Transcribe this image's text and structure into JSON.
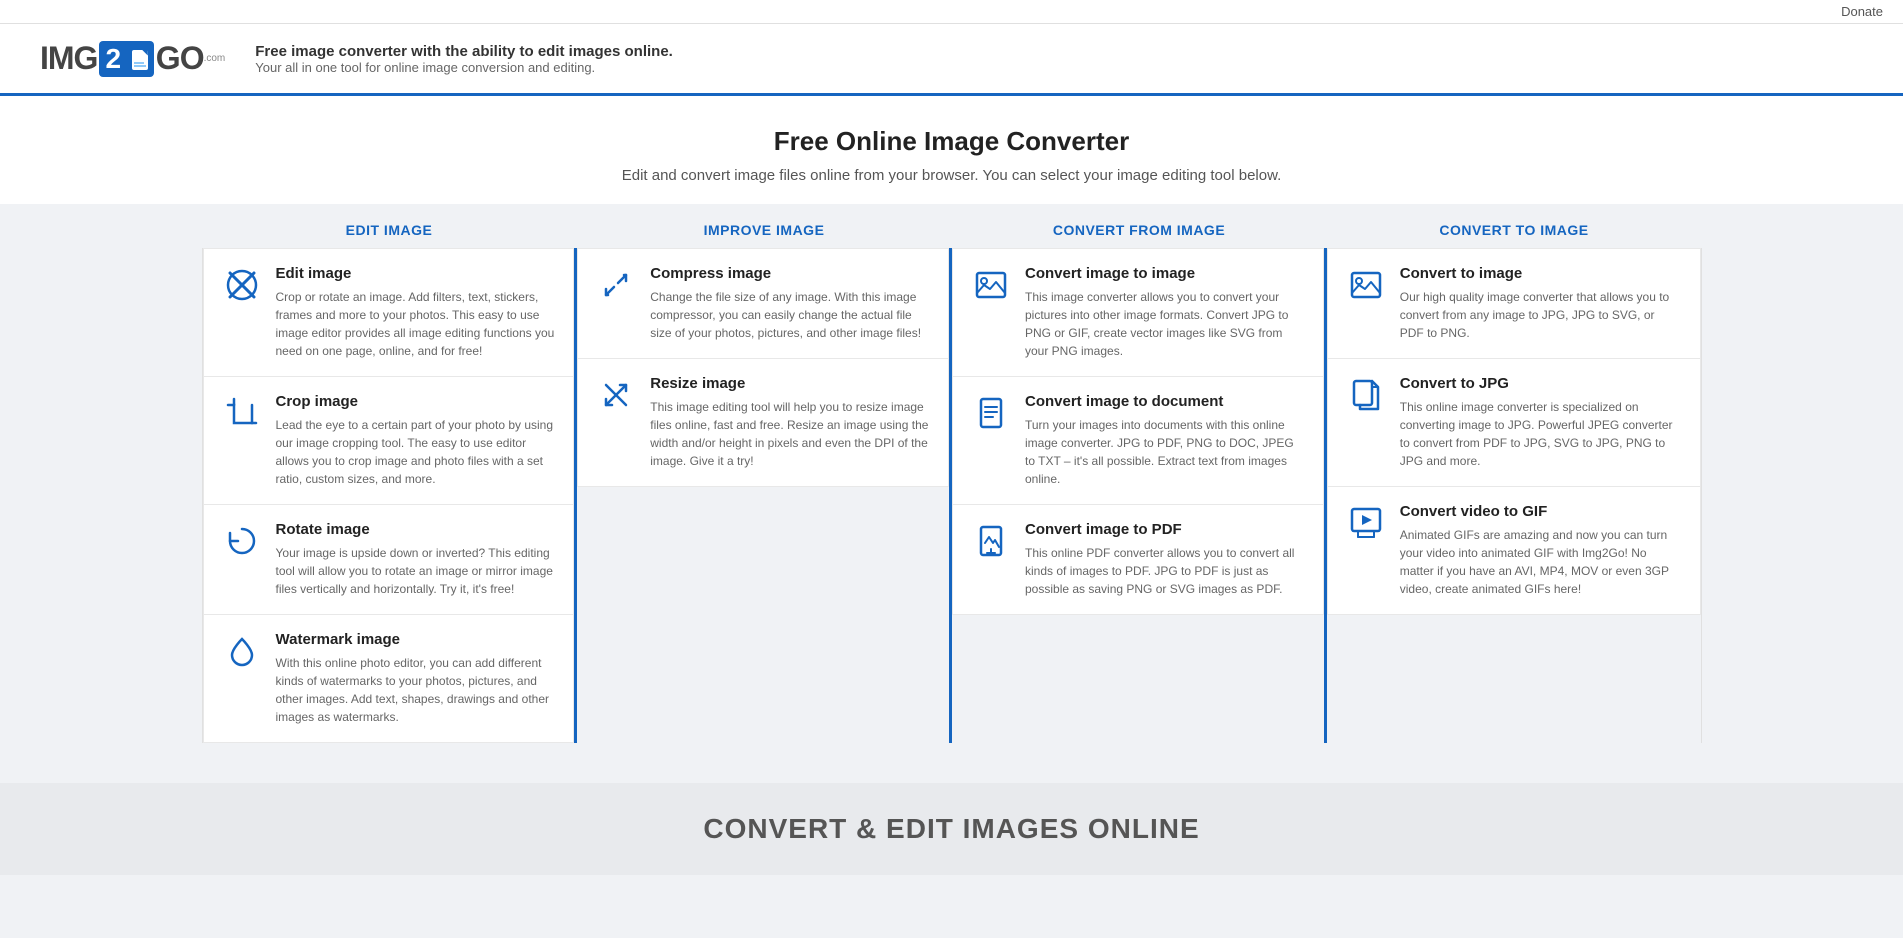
{
  "topbar": {
    "donate_label": "Donate"
  },
  "header": {
    "logo_img": "IMG",
    "logo_2": "2",
    "logo_go": "GO",
    "logo_com": ".com",
    "tagline_bold": "Free image converter with the ability to edit images online.",
    "tagline_sub": "Your all in one tool for online image conversion and editing."
  },
  "hero": {
    "title": "Free Online Image Converter",
    "subtitle": "Edit and convert image files online from your browser. You can select your image editing tool below."
  },
  "columns": [
    {
      "label": "EDIT IMAGE"
    },
    {
      "label": "IMPROVE IMAGE"
    },
    {
      "label": "CONVERT FROM IMAGE"
    },
    {
      "label": "CONVERT TO IMAGE"
    }
  ],
  "cards": {
    "edit": [
      {
        "title": "Edit image",
        "description": "Crop or rotate an image. Add filters, text, stickers, frames and more to your photos. This easy to use image editor provides all image editing functions you need on one page, online, and for free!",
        "icon": "edit"
      },
      {
        "title": "Crop image",
        "description": "Lead the eye to a certain part of your photo by using our image cropping tool. The easy to use editor allows you to crop image and photo files with a set ratio, custom sizes, and more.",
        "icon": "crop"
      },
      {
        "title": "Rotate image",
        "description": "Your image is upside down or inverted? This editing tool will allow you to rotate an image or mirror image files vertically and horizontally. Try it, it's free!",
        "icon": "rotate"
      },
      {
        "title": "Watermark image",
        "description": "With this online photo editor, you can add different kinds of watermarks to your photos, pictures, and other images. Add text, shapes, drawings and other images as watermarks.",
        "icon": "watermark"
      }
    ],
    "improve": [
      {
        "title": "Compress image",
        "description": "Change the file size of any image. With this image compressor, you can easily change the actual file size of your photos, pictures, and other image files!",
        "icon": "compress"
      },
      {
        "title": "Resize image",
        "description": "This image editing tool will help you to resize image files online, fast and free. Resize an image using the width and/or height in pixels and even the DPI of the image. Give it a try!",
        "icon": "resize"
      }
    ],
    "convert_from": [
      {
        "title": "Convert image to image",
        "description": "This image converter allows you to convert your pictures into other image formats. Convert JPG to PNG or GIF, create vector images like SVG from your PNG images.",
        "icon": "img2img"
      },
      {
        "title": "Convert image to document",
        "description": "Turn your images into documents with this online image converter. JPG to PDF, PNG to DOC, JPEG to TXT – it's all possible. Extract text from images online.",
        "icon": "img2doc"
      },
      {
        "title": "Convert image to PDF",
        "description": "This online PDF converter allows you to convert all kinds of images to PDF. JPG to PDF is just as possible as saving PNG or SVG images as PDF.",
        "icon": "img2pdf"
      }
    ],
    "convert_to": [
      {
        "title": "Convert to image",
        "description": "Our high quality image converter that allows you to convert from any image to JPG, JPG to SVG, or PDF to PNG.",
        "icon": "to-image"
      },
      {
        "title": "Convert to JPG",
        "description": "This online image converter is specialized on converting image to JPG. Powerful JPEG converter to convert from PDF to JPG, SVG to JPG, PNG to JPG and more.",
        "icon": "to-jpg"
      },
      {
        "title": "Convert video to GIF",
        "description": "Animated GIFs are amazing and now you can turn your video into animated GIF with Img2Go! No matter if you have an AVI, MP4, MOV or even 3GP video, create animated GIFs here!",
        "icon": "to-gif"
      }
    ]
  },
  "footer": {
    "title": "CONVERT & EDIT IMAGES ONLINE"
  }
}
